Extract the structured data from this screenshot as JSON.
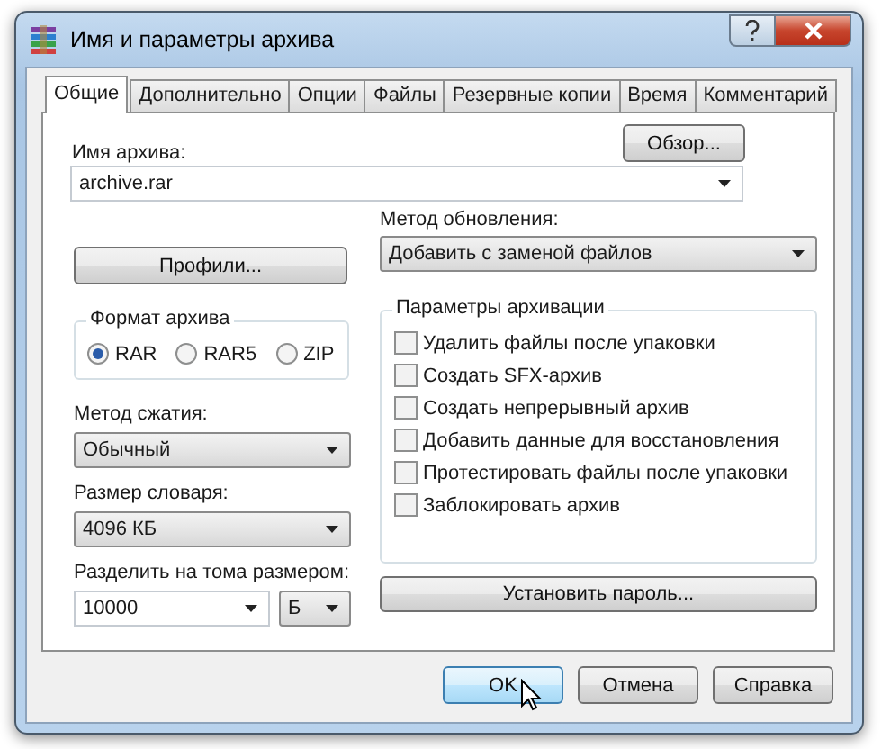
{
  "window": {
    "title": "Имя и параметры архива"
  },
  "tabs": [
    {
      "label": "Общие",
      "selected": true
    },
    {
      "label": "Дополнительно",
      "selected": false
    },
    {
      "label": "Опции",
      "selected": false
    },
    {
      "label": "Файлы",
      "selected": false
    },
    {
      "label": "Резервные копии",
      "selected": false
    },
    {
      "label": "Время",
      "selected": false
    },
    {
      "label": "Комментарий",
      "selected": false
    }
  ],
  "archive_name": {
    "label": "Имя архива:",
    "value": "archive.rar"
  },
  "browse_button": "Обзор...",
  "profiles_button": "Профили...",
  "update_method": {
    "label": "Метод обновления:",
    "value": "Добавить с заменой файлов"
  },
  "archive_format": {
    "title": "Формат архива",
    "options": [
      {
        "label": "RAR",
        "selected": true
      },
      {
        "label": "RAR5",
        "selected": false
      },
      {
        "label": "ZIP",
        "selected": false
      }
    ]
  },
  "archive_options": {
    "title": "Параметры архивации",
    "items": [
      {
        "label": "Удалить файлы после упаковки",
        "checked": false
      },
      {
        "label": "Создать SFX-архив",
        "checked": false
      },
      {
        "label": "Создать непрерывный архив",
        "checked": false
      },
      {
        "label": "Добавить данные для восстановления",
        "checked": false
      },
      {
        "label": "Протестировать файлы после упаковки",
        "checked": false
      },
      {
        "label": "Заблокировать архив",
        "checked": false
      }
    ]
  },
  "compression_method": {
    "label": "Метод сжатия:",
    "value": "Обычный"
  },
  "dictionary_size": {
    "label": "Размер словаря:",
    "value": "4096 КБ"
  },
  "split_volumes": {
    "label": "Разделить на тома размером:",
    "value": "10000",
    "unit": "Б"
  },
  "password_button": "Установить пароль...",
  "buttons": [
    {
      "label": "OK",
      "hovered": true
    },
    {
      "label": "Отмена",
      "hovered": false
    },
    {
      "label": "Справка",
      "hovered": false
    }
  ]
}
